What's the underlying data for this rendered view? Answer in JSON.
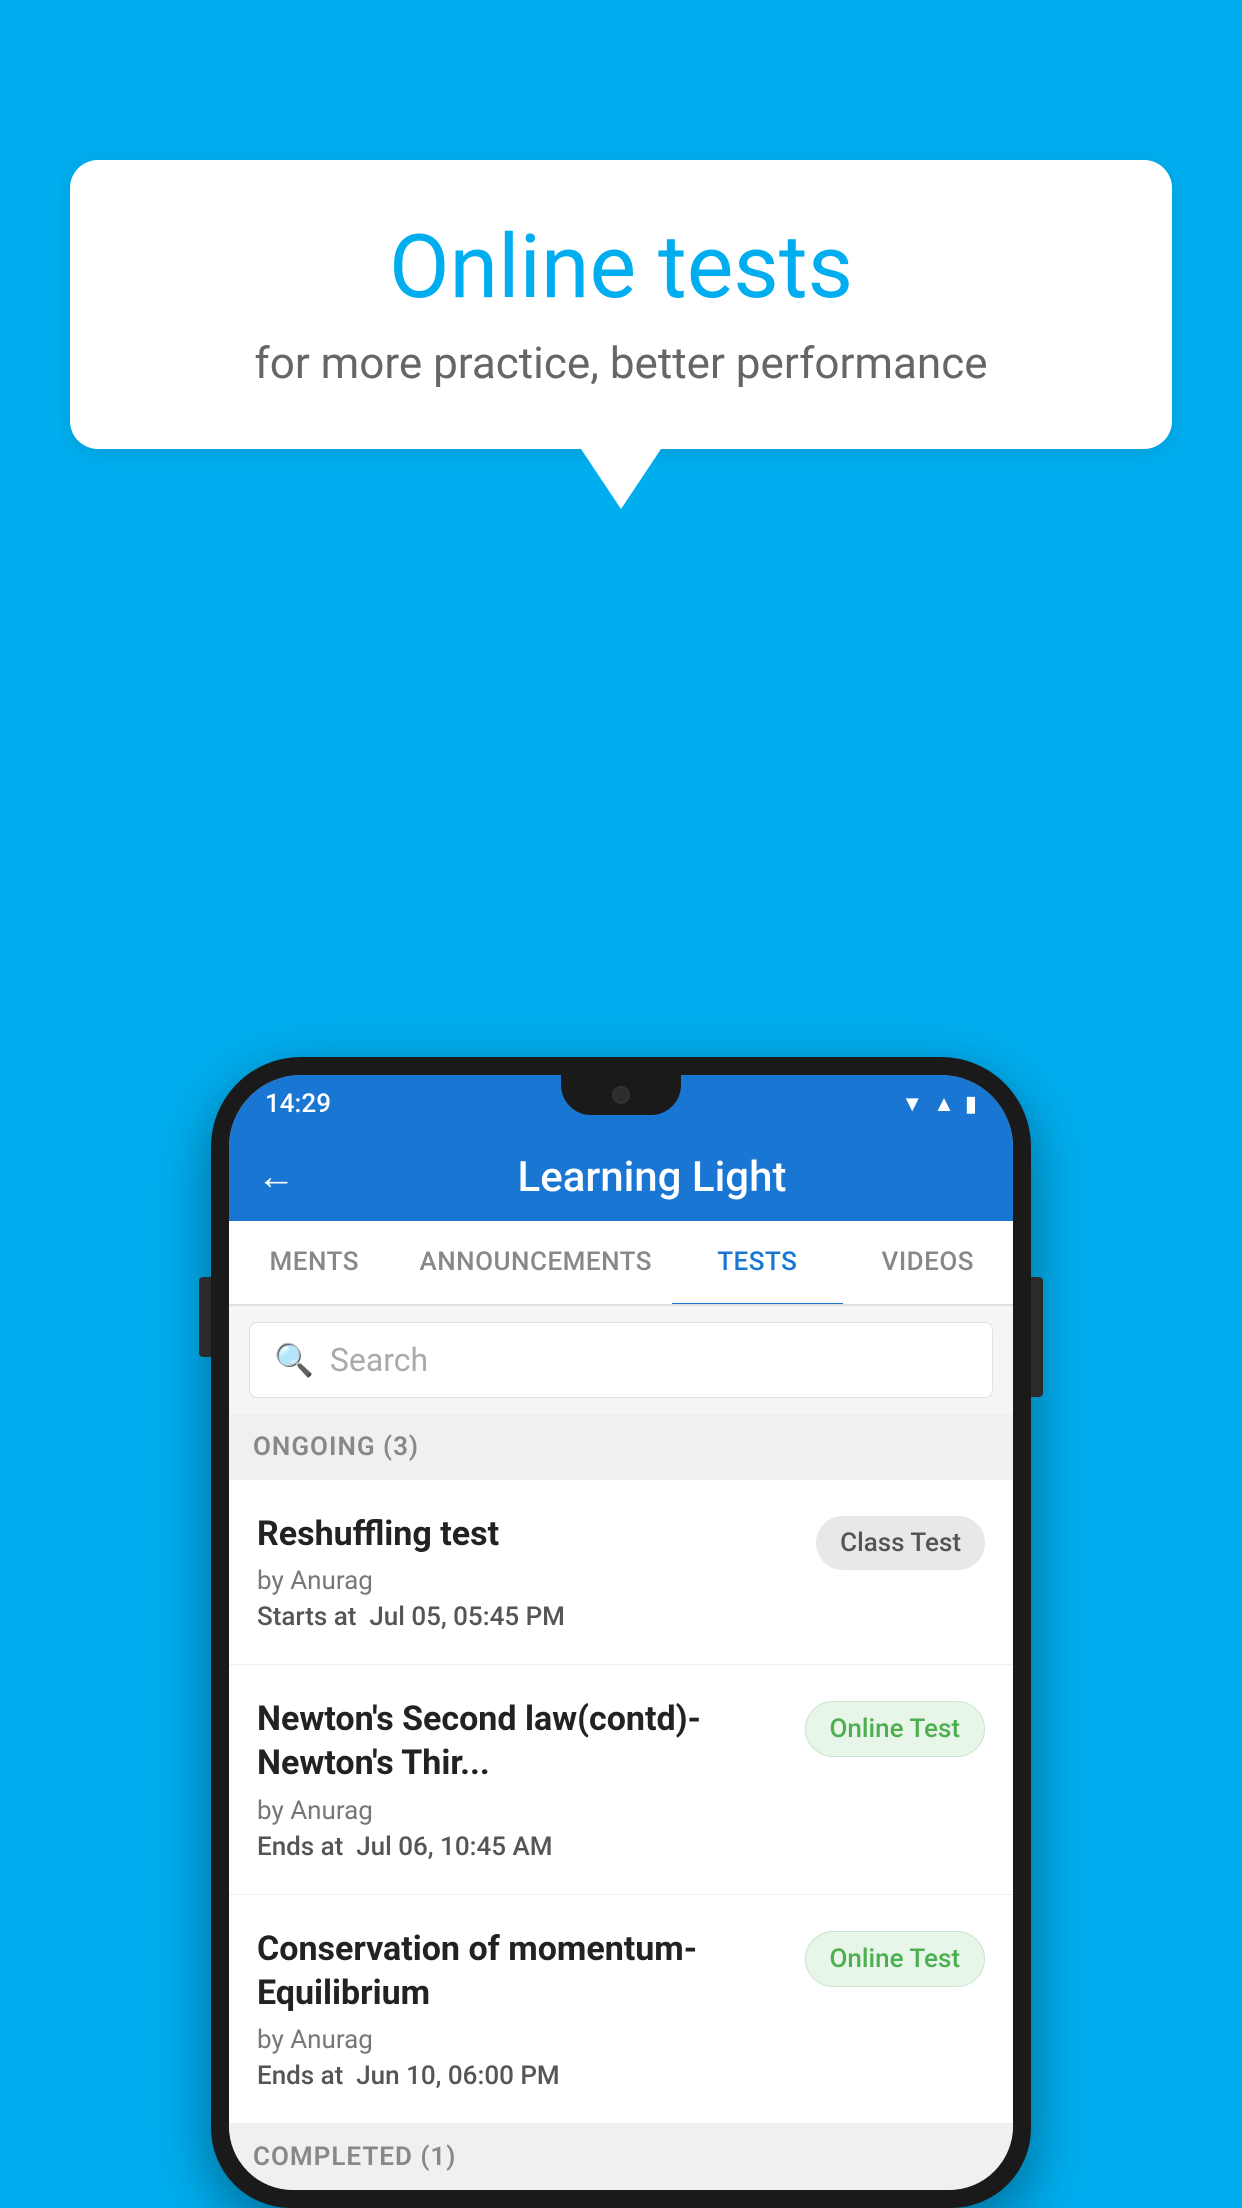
{
  "background": {
    "color": "#00AEEF"
  },
  "speech_bubble": {
    "title": "Online tests",
    "subtitle": "for more practice, better performance"
  },
  "phone": {
    "status_bar": {
      "time": "14:29",
      "icons": [
        "wifi",
        "signal",
        "battery"
      ]
    },
    "app_bar": {
      "title": "Learning Light",
      "back_label": "←"
    },
    "tabs": [
      {
        "label": "MENTS",
        "active": false
      },
      {
        "label": "ANNOUNCEMENTS",
        "active": false
      },
      {
        "label": "TESTS",
        "active": true
      },
      {
        "label": "VIDEOS",
        "active": false
      }
    ],
    "search": {
      "placeholder": "Search"
    },
    "sections": [
      {
        "header": "ONGOING (3)",
        "items": [
          {
            "title": "Reshuffling test",
            "by": "by Anurag",
            "date_label": "Starts at",
            "date": "Jul 05, 05:45 PM",
            "badge": "Class Test",
            "badge_type": "class"
          },
          {
            "title": "Newton's Second law(contd)-Newton's Thir...",
            "by": "by Anurag",
            "date_label": "Ends at",
            "date": "Jul 06, 10:45 AM",
            "badge": "Online Test",
            "badge_type": "online"
          },
          {
            "title": "Conservation of momentum-Equilibrium",
            "by": "by Anurag",
            "date_label": "Ends at",
            "date": "Jun 10, 06:00 PM",
            "badge": "Online Test",
            "badge_type": "online"
          }
        ]
      }
    ],
    "completed_header": "COMPLETED (1)"
  }
}
